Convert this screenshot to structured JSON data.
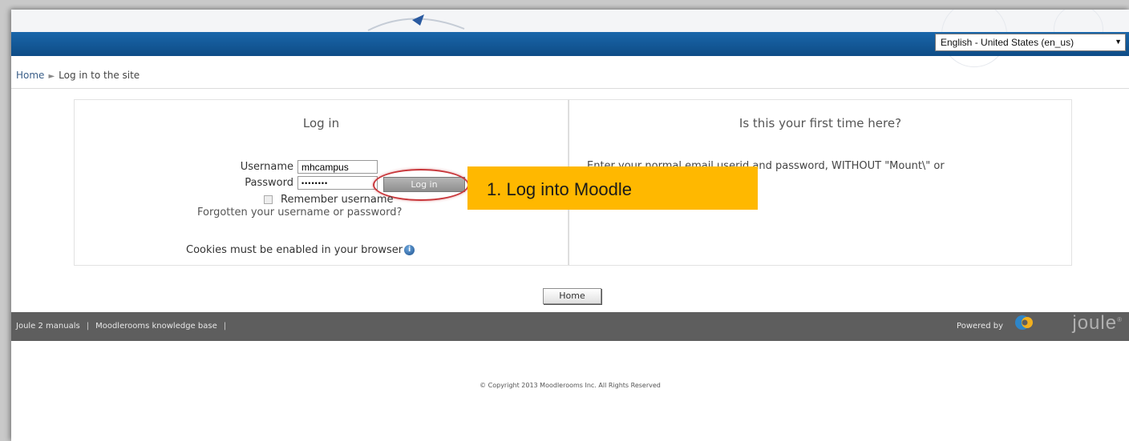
{
  "header": {
    "language_select": "English - United States (en_us)"
  },
  "breadcrumb": {
    "home": "Home",
    "separator": "►",
    "current": "Log in to the site"
  },
  "login": {
    "title": "Log in",
    "username_label": "Username",
    "username_value": "mhcampus",
    "password_label": "Password",
    "password_value": "••••••••",
    "login_button": "Log in",
    "remember_label": "Remember username",
    "forgot_link": "Forgotten your username or password?",
    "cookies_text": "Cookies must be enabled in your browser",
    "info_icon_glyph": "i"
  },
  "first_time": {
    "title": "Is this your first time here?",
    "text": "Enter your normal email userid and password, WITHOUT \"Mount\\\" or"
  },
  "callout": {
    "text": "1. Log into Moodle",
    "color": "#ffb800"
  },
  "home_button": "Home",
  "footer": {
    "links": [
      "Joule 2 manuals",
      "Moodlerooms knowledge base"
    ],
    "powered_by": "Powered by",
    "brand": "joule",
    "brand_mark": "®",
    "copyright": "© Copyright 2013 Moodlerooms Inc. All Rights Reserved"
  },
  "colors": {
    "navbar": "#1a66aa",
    "footer_bar": "#5e5e5e",
    "highlight_ellipse": "#c8373b"
  }
}
